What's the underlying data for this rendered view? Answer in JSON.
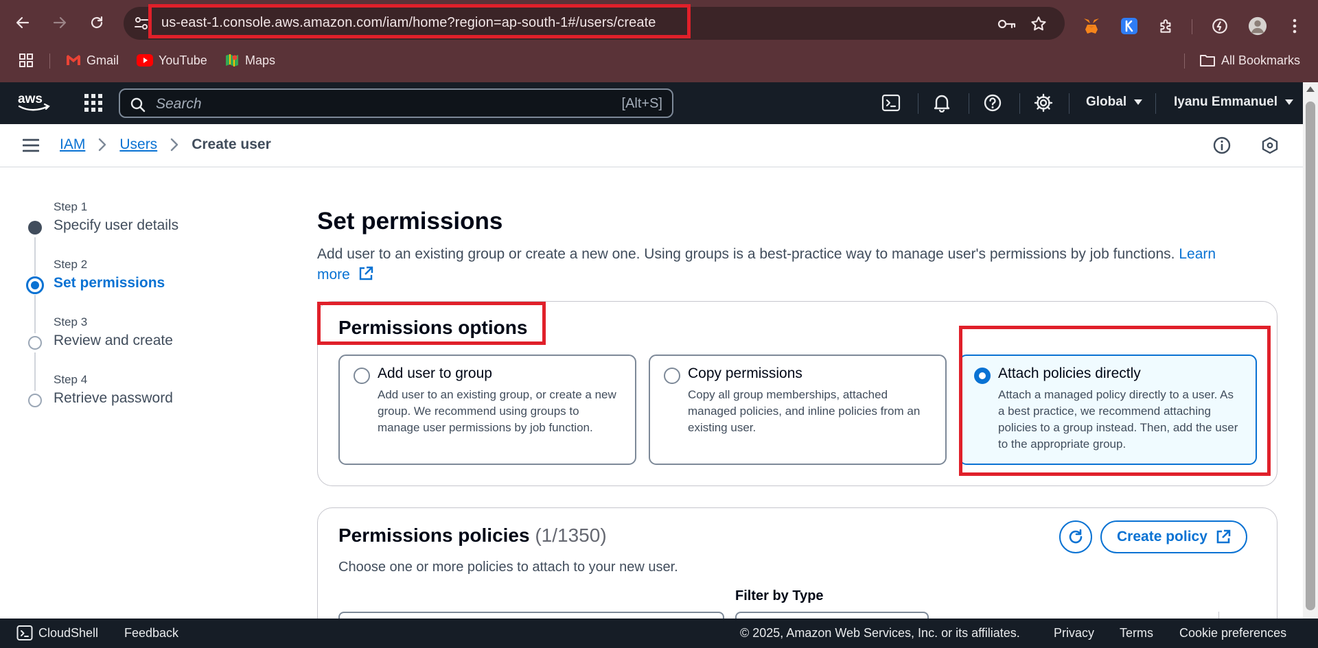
{
  "browser": {
    "url": "us-east-1.console.aws.amazon.com/iam/home?region=ap-south-1#/users/create",
    "bookmarks": [
      {
        "label": "Gmail",
        "icon": "gmail-icon"
      },
      {
        "label": "YouTube",
        "icon": "youtube-icon"
      },
      {
        "label": "Maps",
        "icon": "maps-icon"
      }
    ],
    "all_bookmarks": "All Bookmarks",
    "colors": {
      "frame": "#5a3338",
      "omnibox": "#3b2427"
    }
  },
  "aws": {
    "logo": "aws",
    "search_placeholder": "Search",
    "search_shortcut": "[Alt+S]",
    "region": "Global",
    "user": "Iyanu Emmanuel",
    "colors": {
      "nav": "#161d26",
      "link": "#0972d3"
    }
  },
  "breadcrumb": {
    "items": [
      "IAM",
      "Users"
    ],
    "current": "Create user"
  },
  "steps": [
    {
      "step": "Step 1",
      "title": "Specify user details",
      "state": "complete"
    },
    {
      "step": "Step 2",
      "title": "Set permissions",
      "state": "current"
    },
    {
      "step": "Step 3",
      "title": "Review and create",
      "state": "pending"
    },
    {
      "step": "Step 4",
      "title": "Retrieve password",
      "state": "pending"
    }
  ],
  "main": {
    "title": "Set permissions",
    "description": "Add user to an existing group or create a new one. Using groups is a best-practice way to manage user's permissions by job functions.",
    "learn_more_1": "Learn",
    "learn_more_2": "more",
    "options_title": "Permissions options",
    "options": [
      {
        "title": "Add user to group",
        "desc": "Add user to an existing group, or create a new group. We recommend using groups to manage user permissions by job function.",
        "selected": false
      },
      {
        "title": "Copy permissions",
        "desc": "Copy all group memberships, attached managed policies, and inline policies from an existing user.",
        "selected": false
      },
      {
        "title": "Attach policies directly",
        "desc": "Attach a managed policy directly to a user. As a best practice, we recommend attaching policies to a group instead. Then, add the user to the appropriate group.",
        "selected": true
      }
    ],
    "policies_title": "Permissions policies",
    "policies_count": "(1/1350)",
    "policies_desc": "Choose one or more policies to attach to your new user.",
    "create_policy": "Create policy",
    "filter_by_type": "Filter by Type"
  },
  "footer": {
    "cloudshell": "CloudShell",
    "feedback": "Feedback",
    "copyright": "© 2025, Amazon Web Services, Inc. or its affiliates.",
    "privacy": "Privacy",
    "terms": "Terms",
    "cookies": "Cookie preferences"
  }
}
